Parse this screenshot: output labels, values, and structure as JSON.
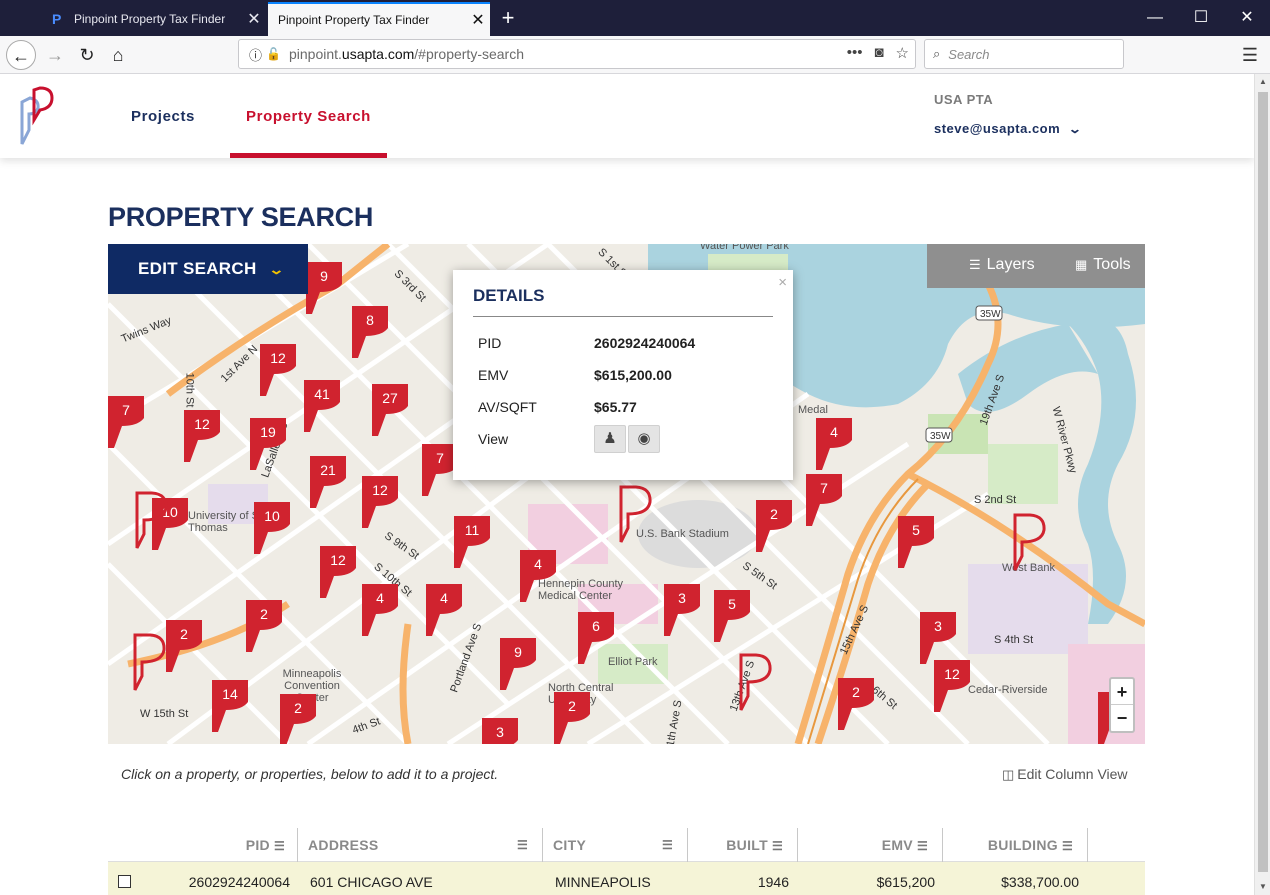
{
  "browser": {
    "tabs": [
      {
        "title": "Pinpoint Property Tax Finder"
      },
      {
        "title": "Pinpoint Property Tax Finder"
      }
    ],
    "url_prefix": "pinpoint.",
    "url_host": "usapta.com",
    "url_path": "/#property-search",
    "search_placeholder": "Search"
  },
  "header": {
    "nav": [
      {
        "label": "Projects"
      },
      {
        "label": "Property Search"
      }
    ],
    "org": "USA PTA",
    "user_email": "steve@usapta.com"
  },
  "page_title": "PROPERTY SEARCH",
  "map": {
    "edit_search_label": "EDIT SEARCH",
    "layers_label": "Layers",
    "tools_label": "Tools",
    "zoom_in": "+",
    "zoom_out": "−",
    "labels": [
      "Water Power Park",
      "S 1st St",
      "S 3rd St",
      "Twins Way",
      "10th St",
      "1st Ave N",
      "LaSalle Ave",
      "University of St. Thomas",
      "U.S. Bank Stadium",
      "Hennepin County Medical Center",
      "Elliot Park",
      "North Central University",
      "Minneapolis Convention Center",
      "W 15th St",
      "4th St",
      "S 2nd St",
      "West Bank",
      "S 4th St",
      "Cedar-Riverside",
      "19th Ave S",
      "W River Pkwy",
      "15th Ave S",
      "6th St",
      "S 5th St",
      "S 9th St",
      "S 10th St",
      "Portland Ave S",
      "13th Ave S",
      "11th Ave S",
      "35W",
      "Medal"
    ],
    "clusters": [
      "9",
      "8",
      "12",
      "41",
      "27",
      "7",
      "12",
      "19",
      "7",
      "21",
      "12",
      "10",
      "10",
      "11",
      "12",
      "4",
      "4",
      "4",
      "9",
      "6",
      "3",
      "5",
      "2",
      "4",
      "7",
      "2",
      "5",
      "3",
      "12",
      "2",
      "2",
      "2",
      "14",
      "2",
      "3",
      "3"
    ]
  },
  "details": {
    "title": "DETAILS",
    "close": "×",
    "rows": [
      {
        "key": "PID",
        "value": "2602924240064"
      },
      {
        "key": "EMV",
        "value": "$615,200.00"
      },
      {
        "key": "AV/SQFT",
        "value": "$65.77"
      },
      {
        "key": "View",
        "value": ""
      }
    ]
  },
  "hint": "Click on a property, or properties, below to add it to a project.",
  "edit_column_view": "Edit Column View",
  "table": {
    "columns": [
      "PID",
      "ADDRESS",
      "CITY",
      "BUILT",
      "EMV",
      "BUILDING"
    ],
    "rows": [
      {
        "pid": "2602924240064",
        "address": "601 CHICAGO AVE",
        "city": "MINNEAPOLIS",
        "built": "1946",
        "emv": "$615,200",
        "building": "$338,700.00"
      }
    ]
  },
  "colors": {
    "navy": "#1b2f5e",
    "brand_red": "#c8102e",
    "pin_red": "#d0232f",
    "selected_row": "#f5f4d7"
  }
}
